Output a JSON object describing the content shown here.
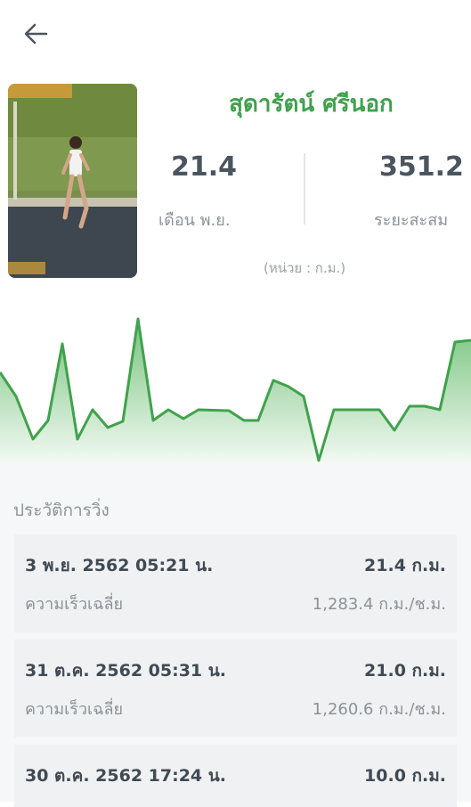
{
  "runner": {
    "name": "สุดารัตน์ ศรีนอก"
  },
  "stats": {
    "month_value": "21.4",
    "month_label": "เดือน พ.ย.",
    "total_value": "351.2",
    "total_label": "ระยะสะสม",
    "unit_note": "(หน่วย : ก.ม.)"
  },
  "history": {
    "title": "ประวัติการวิ่ง",
    "runs": [
      {
        "date": "3 พ.ย. 2562 05:21 น.",
        "distance": "21.4 ก.ม.",
        "speed_label": "ความเร็วเฉลี่ย",
        "speed": "1,283.4 ก.ม./ช.ม."
      },
      {
        "date": "31 ต.ค. 2562 05:31 น.",
        "distance": "21.0 ก.ม.",
        "speed_label": "ความเร็วเฉลี่ย",
        "speed": "1,260.6 ก.ม./ช.ม."
      },
      {
        "date": "30 ต.ค. 2562 17:24 น.",
        "distance": "10.0 ก.ม."
      }
    ]
  },
  "colors": {
    "accent": "#3fa24c",
    "text": "#3f4a55",
    "muted": "#8a9299"
  },
  "icons": {
    "back": "arrow-left-icon"
  }
}
